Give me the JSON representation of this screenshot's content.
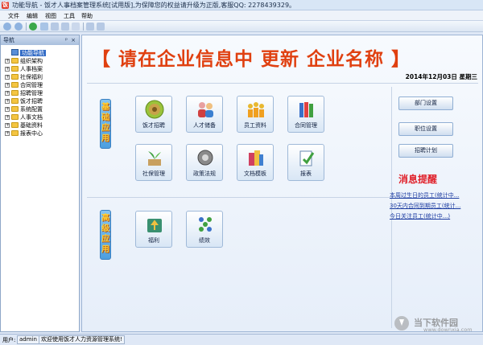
{
  "window": {
    "title": "功能导航 - 饭才人事档案管理系统[试用版],为保障您的权益请升级为正版,客服QQ: 2278439329。"
  },
  "menu": [
    "文件",
    "编辑",
    "视图",
    "工具",
    "帮助"
  ],
  "nav": {
    "header": "导航",
    "pin": "ᵖ",
    "close": "×",
    "root": "功能导航",
    "items": [
      "组织架构",
      "人事档案",
      "社保福利",
      "合同管理",
      "招聘管理",
      "饭才招聘",
      "系统配置",
      "人事文档",
      "基础资料",
      "报表中心"
    ]
  },
  "main": {
    "banner": "【 请在企业信息中 更新 企业名称 】",
    "date": "2014年12月03日 星期三",
    "sections": [
      {
        "label": [
          "基",
          "础",
          "应",
          "用"
        ]
      },
      {
        "label": [
          "高",
          "级",
          "应",
          "用"
        ]
      }
    ],
    "basic_tiles": [
      "饭才招聘",
      "人才储备",
      "员工资料",
      "合同管理",
      "社保管理",
      "政策法规",
      "文档模板",
      "报表"
    ],
    "advanced_tiles": [
      "福利",
      "绩效"
    ],
    "side_buttons": [
      "部门设置",
      "职位设置",
      "招聘计划"
    ],
    "messages": {
      "title": "消息提醒",
      "links": [
        "本周过生日的员工(统计中...",
        "30天内合同到期员工(统计...",
        "今日关注员工(统计中...)"
      ]
    }
  },
  "status": {
    "user_label": "用户:",
    "user": "admin",
    "welcome": "欢迎使用饭才人力资源管理系统!"
  },
  "watermark": {
    "name": "当下软件园",
    "url": "www.downxia.com"
  }
}
